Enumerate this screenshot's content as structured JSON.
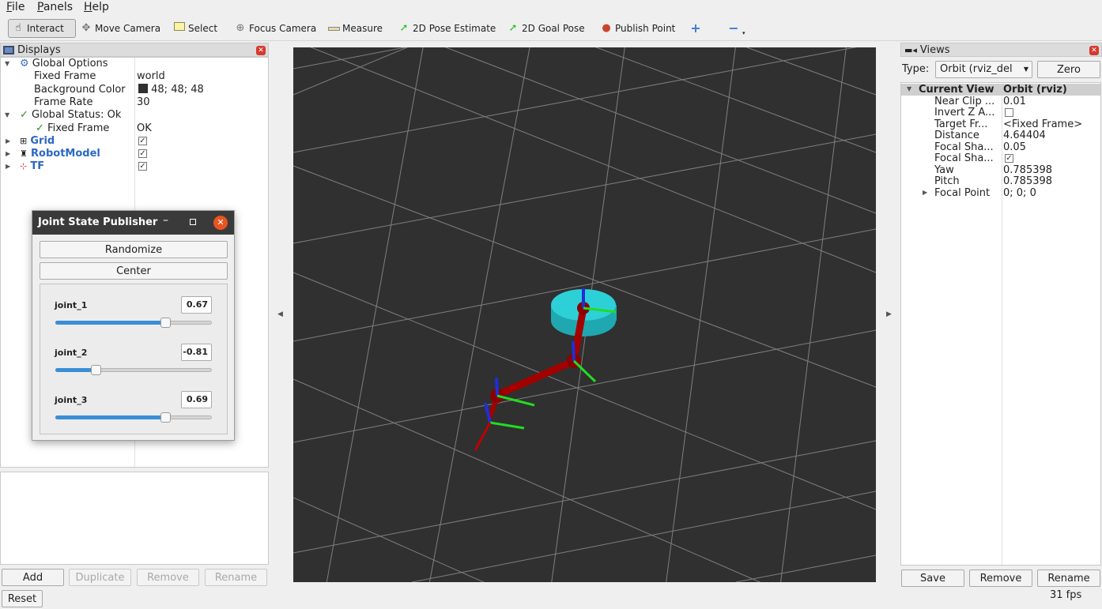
{
  "menubar": {
    "file": "File",
    "panels": "Panels",
    "help": "Help"
  },
  "toolbar": {
    "interact": "Interact",
    "move_camera": "Move Camera",
    "select": "Select",
    "focus_camera": "Focus Camera",
    "measure": "Measure",
    "pose_estimate": "2D Pose Estimate",
    "goal_pose": "2D Goal Pose",
    "publish_point": "Publish Point",
    "add_icon": "plus-icon",
    "remove_icon": "minus-icon"
  },
  "displays": {
    "title": "Displays",
    "global_options": "Global Options",
    "fixed_frame_label": "Fixed Frame",
    "fixed_frame_value": "world",
    "bg_color_label": "Background Color",
    "bg_color_value": "48; 48; 48",
    "frame_rate_label": "Frame Rate",
    "frame_rate_value": "30",
    "global_status": "Global Status: Ok",
    "status_fixed_frame": "Fixed Frame",
    "status_ok": "OK",
    "grid": "Grid",
    "robot_model": "RobotModel",
    "tf": "TF",
    "buttons": {
      "add": "Add",
      "duplicate": "Duplicate",
      "remove": "Remove",
      "rename": "Rename"
    },
    "reset": "Reset"
  },
  "jsp": {
    "title": "Joint State Publisher",
    "randomize": "Randomize",
    "center": "Center",
    "joints": [
      {
        "name": "joint_1",
        "value": "0.67",
        "fraction": 0.7
      },
      {
        "name": "joint_2",
        "value": "-0.81",
        "fraction": 0.26
      },
      {
        "name": "joint_3",
        "value": "0.69",
        "fraction": 0.7
      }
    ]
  },
  "views": {
    "title": "Views",
    "type_label": "Type:",
    "type_value": "Orbit (rviz_del",
    "zero": "Zero",
    "current_view": "Current View",
    "current_view_value": "Orbit (rviz)",
    "props": [
      {
        "label": "Near Clip ...",
        "value": "0.01"
      },
      {
        "label": "Invert Z A...",
        "value": ""
      },
      {
        "label": "Target Fr...",
        "value": "<Fixed Frame>"
      },
      {
        "label": "Distance",
        "value": "4.64404"
      },
      {
        "label": "Focal Sha...",
        "value": "0.05"
      },
      {
        "label": "Focal Sha...",
        "value": ""
      },
      {
        "label": "Yaw",
        "value": "0.785398"
      },
      {
        "label": "Pitch",
        "value": "0.785398"
      },
      {
        "label": "Focal Point",
        "value": "0; 0; 0"
      }
    ],
    "save": "Save",
    "remove": "Remove",
    "rename": "Rename"
  },
  "status": {
    "fps": "31 fps"
  },
  "colors": {
    "background": "#303030",
    "grid": "#a0a0a0",
    "base": "#2ec6cf",
    "link": "#a80000",
    "slider_fill": "#3a8ed6"
  }
}
